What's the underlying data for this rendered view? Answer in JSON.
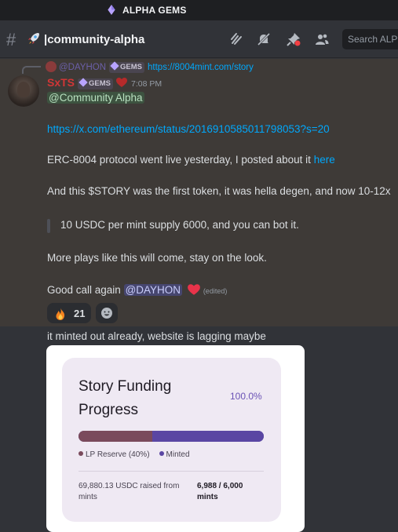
{
  "server": {
    "name": "ALPHA GEMS"
  },
  "channel": {
    "name": "|community-alpha"
  },
  "header": {
    "search_placeholder": "Search ALP"
  },
  "message1": {
    "reply": {
      "author": "@DAYHON",
      "tag": "GEMS",
      "url": "https://8004mint.com/story"
    },
    "author": "SxTS",
    "tag": "GEMS",
    "timestamp": "7:08 PM",
    "mention": "@Community Alpha",
    "link": "https://x.com/ethereum/status/2016910585011798053?s=20",
    "line1_text": "ERC-8004 protocol went live yesterday, I posted about it ",
    "line1_link": "here",
    "line2": "And this $STORY was the first token, it was hella degen, and now 10-12x",
    "quote": "10 USDC per mint supply 6000, and you can bot it.",
    "line3": "More plays like this will come, stay on the look.",
    "line4_text": "Good call again ",
    "line4_mention": "@DAYHON",
    "edited": "(edited)",
    "reaction_count": "21"
  },
  "message2": {
    "text": "it minted out already, website is lagging maybe"
  },
  "attachment": {
    "title": "Story Funding Progress",
    "percent": "100.0%",
    "progress": {
      "lp_reserve_fraction": 0.4,
      "minted_fraction": 0.6
    },
    "legend_lp": "LP Reserve (40%)",
    "legend_minted": "Minted",
    "raised": "69,880.13 USDC raised from mints",
    "minted": "6,988 / 6,000 mints"
  },
  "colors": {
    "accent": "#5865f2",
    "lp_reserve": "#7a4a5c",
    "minted": "#5a46a3",
    "username": "#d13636",
    "link": "#00a8fc"
  }
}
